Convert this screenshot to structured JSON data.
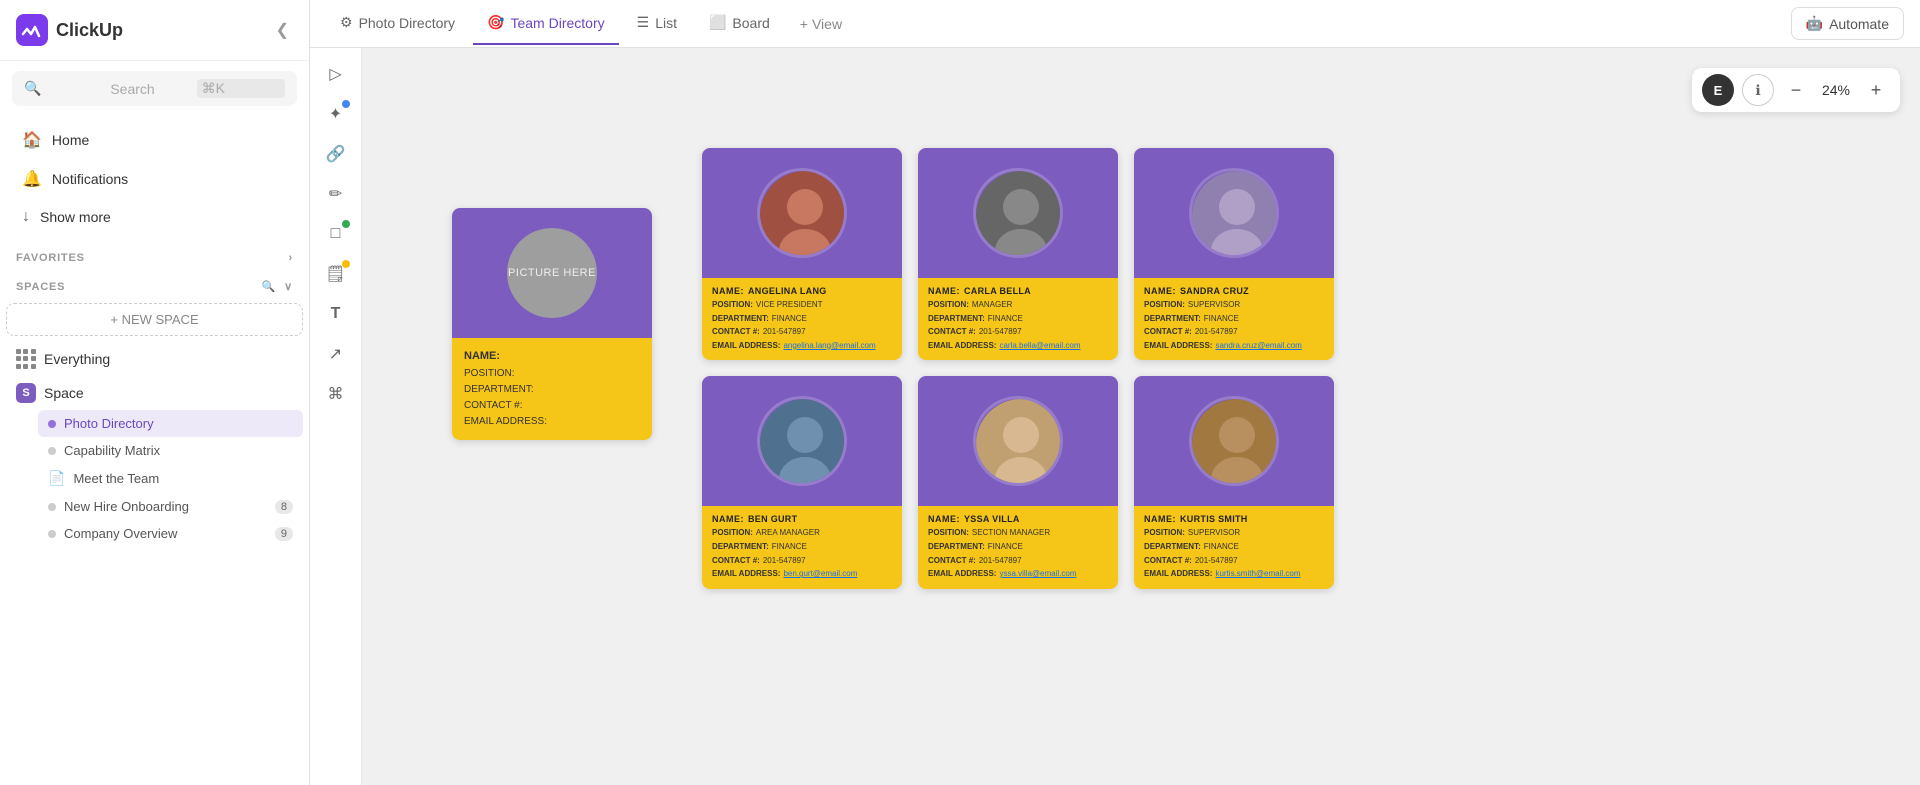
{
  "sidebar": {
    "logo": "ClickUp",
    "search_placeholder": "Search",
    "search_shortcut": "⌘K",
    "nav": [
      {
        "id": "home",
        "label": "Home",
        "icon": "🏠"
      },
      {
        "id": "notifications",
        "label": "Notifications",
        "icon": "🔔"
      },
      {
        "id": "show-more",
        "label": "Show more",
        "icon": "↓"
      }
    ],
    "sections": {
      "favorites": "FAVORITES",
      "spaces": "SPACES"
    },
    "new_space_label": "+ NEW SPACE",
    "space_items": [
      {
        "id": "everything",
        "label": "Everything",
        "type": "everything"
      },
      {
        "id": "space",
        "label": "Space",
        "type": "space"
      }
    ],
    "sub_items": [
      {
        "id": "photo-directory",
        "label": "Photo Directory",
        "active": true,
        "type": "circle"
      },
      {
        "id": "capability-matrix",
        "label": "Capability Matrix",
        "active": false,
        "type": "circle"
      },
      {
        "id": "meet-the-team",
        "label": "Meet the Team",
        "active": false,
        "type": "doc"
      },
      {
        "id": "new-hire-onboarding",
        "label": "New Hire Onboarding",
        "active": false,
        "badge": "8",
        "type": "circle"
      },
      {
        "id": "company-overview",
        "label": "Company Overview",
        "active": false,
        "badge": "9",
        "type": "circle"
      }
    ]
  },
  "tabs": [
    {
      "id": "photo-directory",
      "label": "Photo Directory",
      "icon": "⚙",
      "active": false
    },
    {
      "id": "team-directory",
      "label": "Team Directory",
      "icon": "🎯",
      "active": true
    },
    {
      "id": "list",
      "label": "List",
      "icon": "☰"
    },
    {
      "id": "board",
      "label": "Board",
      "icon": "⬜"
    },
    {
      "id": "view",
      "label": "View",
      "icon": "+"
    }
  ],
  "automate_label": "Automate",
  "zoom": {
    "percent": "24%",
    "user_initial": "E"
  },
  "tools": [
    {
      "id": "cursor",
      "icon": "▷",
      "dot": null
    },
    {
      "id": "magic",
      "icon": "✦",
      "dot": "blue"
    },
    {
      "id": "link",
      "icon": "🔗",
      "dot": null
    },
    {
      "id": "pen",
      "icon": "✏",
      "dot": null
    },
    {
      "id": "shape",
      "icon": "□",
      "dot": "green"
    },
    {
      "id": "sticky",
      "icon": "🗒",
      "dot": "yellow"
    },
    {
      "id": "text",
      "icon": "T",
      "dot": null
    },
    {
      "id": "arrow",
      "icon": "↗",
      "dot": null
    },
    {
      "id": "share",
      "icon": "⌘",
      "dot": null
    }
  ],
  "template_card": {
    "picture_placeholder": "PICTURE HERE",
    "fields": [
      {
        "label": "NAME:",
        "value": ""
      },
      {
        "label": "POSITION:",
        "value": ""
      },
      {
        "label": "DEPARTMENT:",
        "value": ""
      },
      {
        "label": "CONTACT #:",
        "value": ""
      },
      {
        "label": "EMAIL ADDRESS:",
        "value": ""
      }
    ]
  },
  "people": [
    {
      "name": "ANGELINA LANG",
      "position": "VICE PRESIDENT",
      "department": "FINANCE",
      "contact": "201-547897",
      "email": "angelina.lang@email.com",
      "photo_bg": "bg-red"
    },
    {
      "name": "CARLA BELLA",
      "position": "MANAGER",
      "department": "FINANCE",
      "contact": "201-547897",
      "email": "carla.bella@email.com",
      "photo_bg": "bg-gray"
    },
    {
      "name": "SANDRA CRUZ",
      "position": "SUPERVISOR",
      "department": "FINANCE",
      "contact": "201-547897",
      "email": "sandra.cruz@email.com",
      "photo_bg": "bg-light"
    },
    {
      "name": "BEN GURT",
      "position": "AREA MANAGER",
      "department": "FINANCE",
      "contact": "201-547897",
      "email": "ben.gurt@email.com",
      "photo_bg": "bg-blue"
    },
    {
      "name": "YSSA VILLA",
      "position": "SECTION MANAGER",
      "department": "FINANCE",
      "contact": "201-547897",
      "email": "yssa.villa@email.com",
      "photo_bg": "bg-peach"
    },
    {
      "name": "KURTIS SMITH",
      "position": "SUPERVISOR",
      "department": "FINANCE",
      "contact": "201-547897",
      "email": "kurtis.smith@email.com",
      "photo_bg": "bg-tan"
    }
  ],
  "labels": {
    "name": "NAME:",
    "position": "POSITION:",
    "department": "DEPARTMENT:",
    "contact": "CONTACT #:",
    "email": "EMAIL ADDRESS:"
  }
}
